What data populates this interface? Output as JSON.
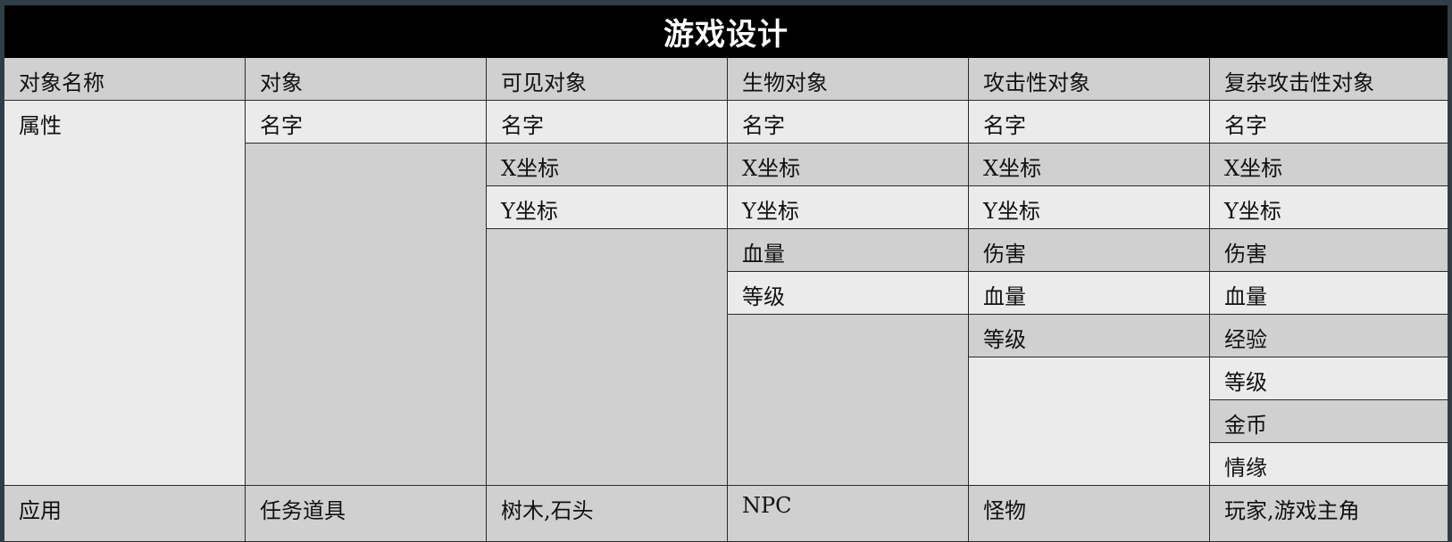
{
  "title": "游戏设计",
  "header": [
    "对象名称",
    "对象",
    "可见对象",
    "生物对象",
    "攻击性对象",
    "复杂攻击性对象"
  ],
  "attributes_label": "属性",
  "columns": {
    "object": [
      "名字"
    ],
    "visible": [
      "名字",
      "X坐标",
      "Y坐标"
    ],
    "creature": [
      "名字",
      "X坐标",
      "Y坐标",
      "血量",
      "等级"
    ],
    "aggressive": [
      "名字",
      "X坐标",
      "Y坐标",
      "伤害",
      "血量",
      "等级"
    ],
    "complex": [
      "名字",
      "X坐标",
      "Y坐标",
      "伤害",
      "血量",
      "经验",
      "等级",
      "金币",
      "情缘"
    ]
  },
  "usage": {
    "label": "应用",
    "object": "任务道具",
    "visible": "树木,石头",
    "creature": "NPC",
    "aggressive": "怪物",
    "complex": "玩家,游戏主角"
  }
}
